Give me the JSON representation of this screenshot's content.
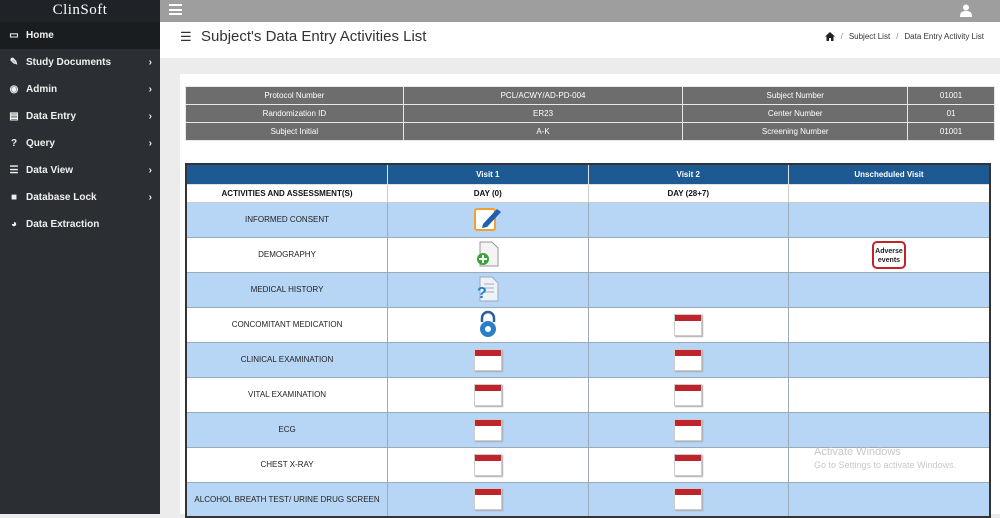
{
  "brand": "ClinSoft",
  "nav": [
    {
      "label": "Home",
      "icon": "laptop-icon",
      "glyph": "▭",
      "active": true,
      "chevron": false
    },
    {
      "label": "Study Documents",
      "icon": "edit-icon",
      "glyph": "✎",
      "chevron": true
    },
    {
      "label": "Admin",
      "icon": "car-icon",
      "glyph": "◉",
      "chevron": true
    },
    {
      "label": "Data Entry",
      "icon": "file-icon",
      "glyph": "▤",
      "chevron": true
    },
    {
      "label": "Query",
      "icon": "question-icon",
      "glyph": "?",
      "chevron": true
    },
    {
      "label": "Data View",
      "icon": "table-icon",
      "glyph": "☰",
      "chevron": true
    },
    {
      "label": "Database Lock",
      "icon": "lock-icon",
      "glyph": "■",
      "chevron": true
    },
    {
      "label": "Data Extraction",
      "icon": "pie-chart-icon",
      "glyph": "◕",
      "chevron": false
    }
  ],
  "header": {
    "title": "Subject's Data Entry Activities List",
    "breadcrumb": [
      "Subject List",
      "Data Entry Activity List"
    ]
  },
  "info": {
    "protocol_label": "Protocol Number",
    "protocol_value": "PCL/ACWY/AD-PD-004",
    "subject_number_label": "Subject Number",
    "subject_number_value": "01001",
    "randomization_label": "Randomization ID",
    "randomization_value": "ER23",
    "center_label": "Center Number",
    "center_value": "01",
    "initial_label": "Subject Initial",
    "initial_value": "A-K",
    "screening_label": "Screening Number",
    "screening_value": "01001"
  },
  "table": {
    "columns": [
      "",
      "Visit 1",
      "Visit 2",
      "Unscheduled Visit"
    ],
    "subheader": [
      "ACTIVITIES AND ASSESSMENT(S)",
      "DAY (0)",
      "DAY (28+7)",
      ""
    ],
    "rows": [
      {
        "label": "INFORMED CONSENT",
        "v1": "edit-form-icon",
        "v2": "",
        "u": ""
      },
      {
        "label": "DEMOGRAPHY",
        "v1": "add-document-icon",
        "v2": "",
        "u": "adverse-events-icon"
      },
      {
        "label": "MEDICAL HISTORY",
        "v1": "help-document-icon",
        "v2": "",
        "u": ""
      },
      {
        "label": "CONCOMITANT MEDICATION",
        "v1": "lock-badge-icon",
        "v2": "calendar-icon",
        "u": ""
      },
      {
        "label": "CLINICAL EXAMINATION",
        "v1": "calendar-icon",
        "v2": "calendar-icon",
        "u": ""
      },
      {
        "label": "VITAL EXAMINATION",
        "v1": "calendar-icon",
        "v2": "calendar-icon",
        "u": ""
      },
      {
        "label": "ECG",
        "v1": "calendar-icon",
        "v2": "calendar-icon",
        "u": ""
      },
      {
        "label": "CHEST X-RAY",
        "v1": "calendar-icon",
        "v2": "calendar-icon",
        "u": ""
      },
      {
        "label": "ALCOHOL BREATH TEST/ URINE DRUG SCREEN",
        "v1": "calendar-icon",
        "v2": "calendar-icon",
        "u": ""
      }
    ],
    "adverse_events_text": "Adverse events"
  },
  "watermark": {
    "line1": "Activate Windows",
    "line2": "Go to Settings to activate Windows."
  },
  "colors": {
    "sidebar": "#2b2f33",
    "table_header": "#1d5a93",
    "row_blue": "#b7d5f5",
    "calendar_red": "#c0242b"
  }
}
